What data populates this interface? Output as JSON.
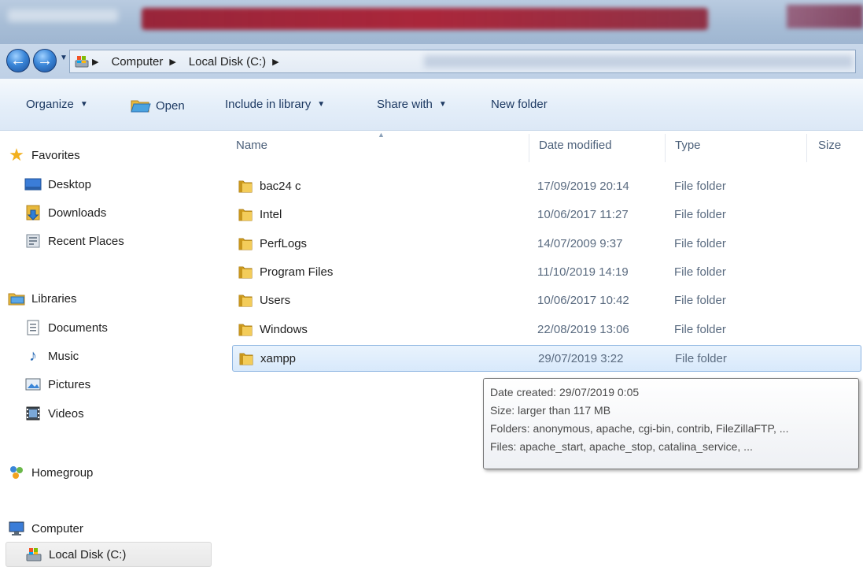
{
  "address": {
    "crumbs": [
      "Computer",
      "Local Disk (C:)"
    ]
  },
  "toolbar": {
    "organize": "Organize",
    "open": "Open",
    "include_in_library": "Include in library",
    "share_with": "Share with",
    "new_folder": "New folder"
  },
  "nav": {
    "favorites": "Favorites",
    "desktop": "Desktop",
    "downloads": "Downloads",
    "recent_places": "Recent Places",
    "libraries": "Libraries",
    "documents": "Documents",
    "music": "Music",
    "pictures": "Pictures",
    "videos": "Videos",
    "homegroup": "Homegroup",
    "computer": "Computer",
    "local_disk": "Local Disk (C:)"
  },
  "columns": {
    "name": "Name",
    "date_modified": "Date modified",
    "type": "Type",
    "size": "Size"
  },
  "files": [
    {
      "name": "bac24 c",
      "date": "17/09/2019 20:14",
      "type": "File folder"
    },
    {
      "name": "Intel",
      "date": "10/06/2017 11:27",
      "type": "File folder"
    },
    {
      "name": "PerfLogs",
      "date": "14/07/2009 9:37",
      "type": "File folder"
    },
    {
      "name": "Program Files",
      "date": "11/10/2019 14:19",
      "type": "File folder"
    },
    {
      "name": "Users",
      "date": "10/06/2017 10:42",
      "type": "File folder"
    },
    {
      "name": "Windows",
      "date": "22/08/2019 13:06",
      "type": "File folder"
    },
    {
      "name": "xampp",
      "date": "29/07/2019 3:22",
      "type": "File folder"
    }
  ],
  "tooltip": {
    "line1": "Date created: 29/07/2019 0:05",
    "line2": "Size: larger than 117 MB",
    "line3": "Folders: anonymous, apache, cgi-bin, contrib, FileZillaFTP, ...",
    "line4": "Files: apache_start, apache_stop, catalina_service, ..."
  },
  "colors": {
    "selection_bg": "#d8e9fb",
    "selection_border": "#8cb4e1",
    "toolbar_text": "#1e3a63",
    "folder": "#e8b93c"
  }
}
